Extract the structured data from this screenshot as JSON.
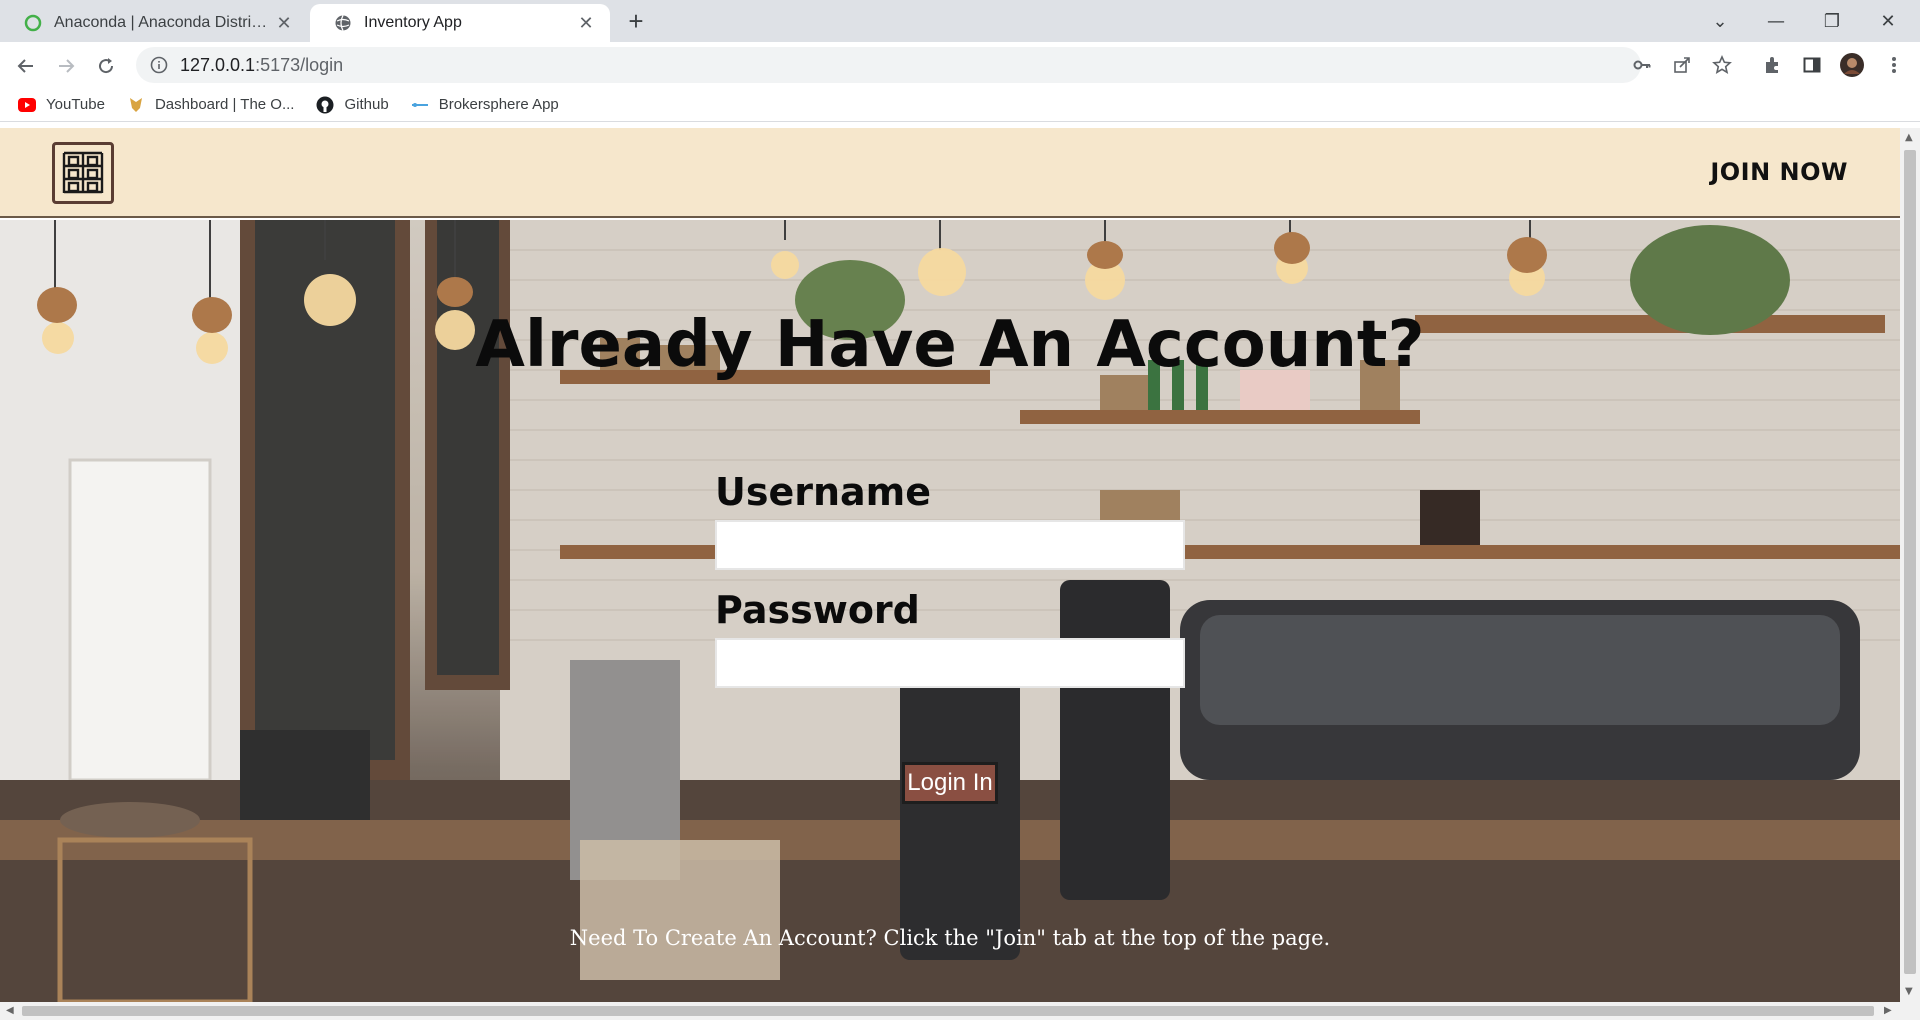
{
  "browser": {
    "tabs": [
      {
        "title": "Anaconda | Anaconda Distributio",
        "active": false
      },
      {
        "title": "Inventory App",
        "active": true
      }
    ],
    "new_tab_label": "+",
    "address": {
      "host": "127.0.0.1",
      "path": ":5173/login"
    },
    "bookmarks": [
      {
        "label": "YouTube",
        "icon": "youtube-icon"
      },
      {
        "label": "Dashboard | The O...",
        "icon": "odin-icon"
      },
      {
        "label": "Github",
        "icon": "github-icon"
      },
      {
        "label": "Brokersphere App",
        "icon": "brokersphere-icon"
      }
    ]
  },
  "page": {
    "navbar": {
      "join_label": "JOIN NOW",
      "logo_icon": "warehouse-shelves-icon"
    },
    "heading": "Already Have An Account?",
    "form": {
      "username_label": "Username",
      "username_value": "",
      "password_label": "Password",
      "password_value": "",
      "submit_label": "Login In"
    },
    "footer_note": "Need To Create An Account? Click the \"Join\" tab at the top of the page."
  },
  "colors": {
    "navbar_bg": "#f6e7cc",
    "button_bg": "#8a4f42",
    "heading_text": "#0b0b0b"
  }
}
